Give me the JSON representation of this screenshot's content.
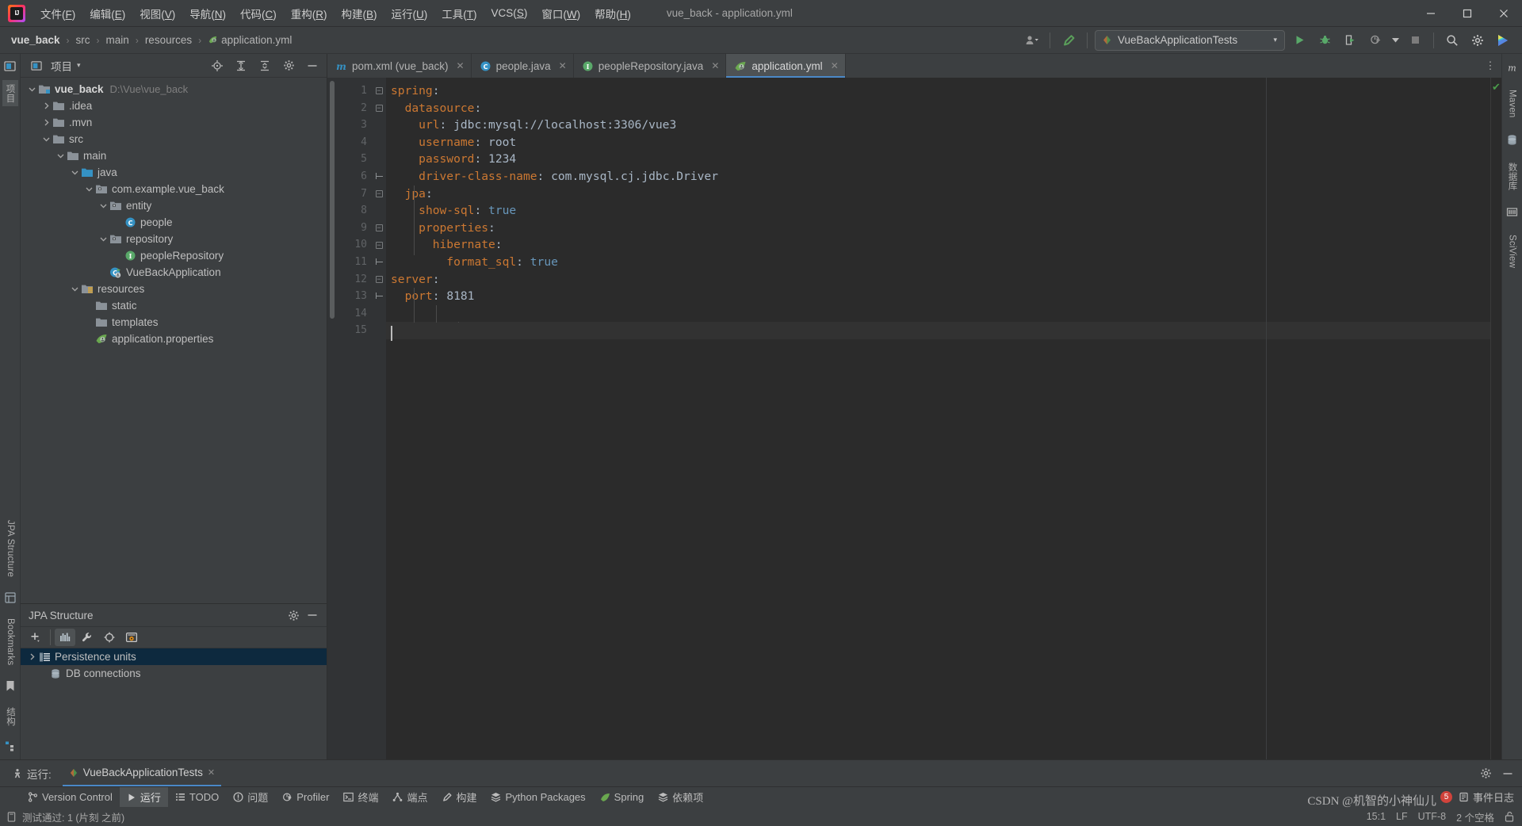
{
  "window": {
    "title": "vue_back - application.yml",
    "minimize": "—",
    "maximize": "▢",
    "close": "✕"
  },
  "menubar": {
    "logo_text": "IJ",
    "items": [
      {
        "label": "文件(F)",
        "mnemonic": "F"
      },
      {
        "label": "编辑(E)",
        "mnemonic": "E"
      },
      {
        "label": "视图(V)",
        "mnemonic": "V"
      },
      {
        "label": "导航(N)",
        "mnemonic": "N"
      },
      {
        "label": "代码(C)",
        "mnemonic": "C"
      },
      {
        "label": "重构(R)",
        "mnemonic": "R"
      },
      {
        "label": "构建(B)",
        "mnemonic": "B"
      },
      {
        "label": "运行(U)",
        "mnemonic": "U"
      },
      {
        "label": "工具(T)",
        "mnemonic": "T"
      },
      {
        "label": "VCS(S)",
        "mnemonic": "S"
      },
      {
        "label": "窗口(W)",
        "mnemonic": "W"
      },
      {
        "label": "帮助(H)",
        "mnemonic": "H"
      }
    ]
  },
  "navbar": {
    "breadcrumbs": [
      "vue_back",
      "src",
      "main",
      "resources",
      "application.yml"
    ],
    "separator": "›",
    "run_config": "VueBackApplicationTests",
    "run_config_caret": "▾",
    "icons": [
      "user-icon",
      "build-hammer-icon",
      "run-icon",
      "debug-icon",
      "run-coverage-icon",
      "profiler-icon",
      "stop-icon",
      "search-icon",
      "settings-icon",
      "ide-assistant-icon"
    ]
  },
  "project_panel": {
    "title": "项目",
    "title_caret": "▾",
    "header_icons": [
      "locate-icon",
      "expand-all-icon",
      "collapse-all-icon",
      "settings-icon",
      "hide-icon"
    ],
    "tree": [
      {
        "label": "vue_back",
        "path": "D:\\Vue\\vue_back",
        "depth": 0,
        "arrow": "down",
        "icon": "module-folder-icon",
        "bold": true
      },
      {
        "label": ".idea",
        "path": "",
        "depth": 1,
        "arrow": "right",
        "icon": "folder-icon",
        "bold": false
      },
      {
        "label": ".mvn",
        "path": "",
        "depth": 1,
        "arrow": "right",
        "icon": "folder-icon",
        "bold": false
      },
      {
        "label": "src",
        "path": "",
        "depth": 1,
        "arrow": "down",
        "icon": "folder-icon",
        "bold": false
      },
      {
        "label": "main",
        "path": "",
        "depth": 2,
        "arrow": "down",
        "icon": "folder-icon",
        "bold": false
      },
      {
        "label": "java",
        "path": "",
        "depth": 3,
        "arrow": "down",
        "icon": "source-folder-icon",
        "bold": false
      },
      {
        "label": "com.example.vue_back",
        "path": "",
        "depth": 4,
        "arrow": "down",
        "icon": "package-icon",
        "bold": false
      },
      {
        "label": "entity",
        "path": "",
        "depth": 5,
        "arrow": "down",
        "icon": "package-icon",
        "bold": false
      },
      {
        "label": "people",
        "path": "",
        "depth": 6,
        "arrow": "none",
        "icon": "java-class-icon",
        "bold": false
      },
      {
        "label": "repository",
        "path": "",
        "depth": 5,
        "arrow": "down",
        "icon": "package-icon",
        "bold": false
      },
      {
        "label": "peopleRepository",
        "path": "",
        "depth": 6,
        "arrow": "none",
        "icon": "java-interface-icon",
        "bold": false
      },
      {
        "label": "VueBackApplication",
        "path": "",
        "depth": 5,
        "arrow": "none",
        "icon": "spring-class-icon",
        "bold": false
      },
      {
        "label": "resources",
        "path": "",
        "depth": 3,
        "arrow": "down",
        "icon": "resource-folder-icon",
        "bold": false
      },
      {
        "label": "static",
        "path": "",
        "depth": 4,
        "arrow": "none",
        "icon": "folder-icon",
        "bold": false
      },
      {
        "label": "templates",
        "path": "",
        "depth": 4,
        "arrow": "none",
        "icon": "folder-icon",
        "bold": false
      },
      {
        "label": "application.properties",
        "path": "",
        "depth": 4,
        "arrow": "none",
        "icon": "spring-leaf-icon",
        "bold": false
      }
    ]
  },
  "jpa_panel": {
    "title": "JPA Structure",
    "header_icons": [
      "settings-icon",
      "hide-icon"
    ],
    "toolbar_icons": [
      "add-icon",
      "chart-icon",
      "wrench-icon",
      "target-icon",
      "preview-icon"
    ],
    "items": [
      {
        "label": "Persistence units",
        "arrow": "right",
        "icon": "persistence-unit-icon",
        "selected": true
      },
      {
        "label": "DB connections",
        "arrow": "none",
        "icon": "database-icon",
        "selected": false
      }
    ]
  },
  "editor": {
    "tabs": [
      {
        "label": "pom.xml (vue_back)",
        "icon": "maven-icon",
        "active": false,
        "close": "✕"
      },
      {
        "label": "people.java",
        "icon": "java-class-icon",
        "active": false,
        "close": "✕"
      },
      {
        "label": "peopleRepository.java",
        "icon": "java-interface-icon",
        "active": false,
        "close": "✕"
      },
      {
        "label": "application.yml",
        "icon": "spring-leaf-icon",
        "active": true,
        "close": "✕"
      }
    ],
    "more_icon": "⋮",
    "inspection_status": "✔",
    "lines": [
      {
        "n": "1",
        "fold": "open",
        "indent": 0,
        "tokens": [
          {
            "t": "spring",
            "c": "kw"
          },
          {
            "t": ":",
            "c": "punc"
          }
        ]
      },
      {
        "n": "2",
        "fold": "open",
        "indent": 2,
        "tokens": [
          {
            "t": "datasource",
            "c": "kw"
          },
          {
            "t": ":",
            "c": "punc"
          }
        ]
      },
      {
        "n": "3",
        "fold": "none",
        "indent": 4,
        "tokens": [
          {
            "t": "url",
            "c": "kw"
          },
          {
            "t": ": ",
            "c": "punc"
          },
          {
            "t": "jdbc:mysql://localhost:3306/vue3",
            "c": "val"
          }
        ]
      },
      {
        "n": "4",
        "fold": "none",
        "indent": 4,
        "tokens": [
          {
            "t": "username",
            "c": "kw"
          },
          {
            "t": ": ",
            "c": "punc"
          },
          {
            "t": "root",
            "c": "val"
          }
        ]
      },
      {
        "n": "5",
        "fold": "none",
        "indent": 4,
        "tokens": [
          {
            "t": "password",
            "c": "kw"
          },
          {
            "t": ": ",
            "c": "punc"
          },
          {
            "t": "1234",
            "c": "val"
          }
        ]
      },
      {
        "n": "6",
        "fold": "end",
        "indent": 4,
        "tokens": [
          {
            "t": "driver-class-name",
            "c": "kw"
          },
          {
            "t": ": ",
            "c": "punc"
          },
          {
            "t": "com.mysql.cj.jdbc.Driver",
            "c": "val"
          }
        ]
      },
      {
        "n": "7",
        "fold": "open",
        "indent": 2,
        "tokens": [
          {
            "t": "jpa",
            "c": "kw"
          },
          {
            "t": ":",
            "c": "punc"
          }
        ]
      },
      {
        "n": "8",
        "fold": "none",
        "indent": 4,
        "tokens": [
          {
            "t": "show-sql",
            "c": "kw"
          },
          {
            "t": ": ",
            "c": "punc"
          },
          {
            "t": "true",
            "c": "num"
          }
        ]
      },
      {
        "n": "9",
        "fold": "open",
        "indent": 4,
        "tokens": [
          {
            "t": "properties",
            "c": "kw"
          },
          {
            "t": ":",
            "c": "punc"
          }
        ]
      },
      {
        "n": "10",
        "fold": "open",
        "indent": 6,
        "tokens": [
          {
            "t": "hibernate",
            "c": "kw"
          },
          {
            "t": ":",
            "c": "punc"
          }
        ]
      },
      {
        "n": "11",
        "fold": "end",
        "indent": 8,
        "tokens": [
          {
            "t": "format_sql",
            "c": "kw"
          },
          {
            "t": ": ",
            "c": "punc"
          },
          {
            "t": "true",
            "c": "num"
          }
        ]
      },
      {
        "n": "12",
        "fold": "open",
        "indent": 0,
        "tokens": [
          {
            "t": "server",
            "c": "kw"
          },
          {
            "t": ":",
            "c": "punc"
          }
        ]
      },
      {
        "n": "13",
        "fold": "end",
        "indent": 2,
        "tokens": [
          {
            "t": "port",
            "c": "kw"
          },
          {
            "t": ": ",
            "c": "punc"
          },
          {
            "t": "8181",
            "c": "val"
          }
        ]
      },
      {
        "n": "14",
        "fold": "none",
        "indent": 0,
        "tokens": []
      },
      {
        "n": "15",
        "fold": "none",
        "indent": 0,
        "tokens": []
      }
    ]
  },
  "run_window": {
    "label": "运行:",
    "tab": "VueBackApplicationTests",
    "tab_close": "✕",
    "right_icons": [
      "settings-icon",
      "hide-icon"
    ]
  },
  "bottom_toolbar": {
    "items": [
      {
        "label": "Version Control",
        "icon": "branch-icon",
        "selected": false
      },
      {
        "label": "运行",
        "icon": "run-icon",
        "selected": true
      },
      {
        "label": "TODO",
        "icon": "todo-icon",
        "selected": false
      },
      {
        "label": "问题",
        "icon": "problems-icon",
        "selected": false
      },
      {
        "label": "Profiler",
        "icon": "profiler-icon",
        "selected": false
      },
      {
        "label": "终端",
        "icon": "terminal-icon",
        "selected": false
      },
      {
        "label": "端点",
        "icon": "endpoints-icon",
        "selected": false
      },
      {
        "label": "构建",
        "icon": "build-hammer-icon",
        "selected": false
      },
      {
        "label": "Python Packages",
        "icon": "packages-icon",
        "selected": false
      },
      {
        "label": "Spring",
        "icon": "spring-leaf-icon",
        "selected": false
      },
      {
        "label": "依赖项",
        "icon": "dependencies-icon",
        "selected": false
      }
    ],
    "right": {
      "badge": "5",
      "label": "事件日志",
      "icon": "event-log-icon"
    }
  },
  "status_bar": {
    "message": "测试通过: 1 (片刻 之前)",
    "message_icon": "test-passed-icon",
    "caret_position": "15:1",
    "line_separator": "LF",
    "encoding": "UTF-8",
    "indent": "2 个空格",
    "lock_icon": "unlock-icon"
  },
  "left_rail": {
    "tabs": [
      {
        "label": "项目",
        "icon": "project-icon",
        "selected": true
      },
      {
        "label": "结构",
        "icon": "structure-icon",
        "selected": false
      },
      {
        "label": "Bookmarks",
        "icon": "bookmark-icon",
        "selected": false
      },
      {
        "label": "JPA Structure",
        "icon": "jpa-icon",
        "selected": false
      }
    ]
  },
  "right_rail": {
    "tabs": [
      {
        "label": "Maven",
        "icon": "maven-icon",
        "selected": false
      },
      {
        "label": "数据库",
        "icon": "database-icon",
        "selected": false
      },
      {
        "label": "SciView",
        "icon": "sciview-icon",
        "selected": false
      }
    ]
  },
  "watermark": {
    "text": "CSDN @机智的小神仙儿"
  },
  "colors": {
    "accent": "#4a88c7",
    "selection": "#0d293e",
    "editor_bg": "#2b2b2b",
    "panel_bg": "#3c3f41",
    "keyword": "#cc7832",
    "number": "#6897bb",
    "value": "#a9b7c6"
  }
}
